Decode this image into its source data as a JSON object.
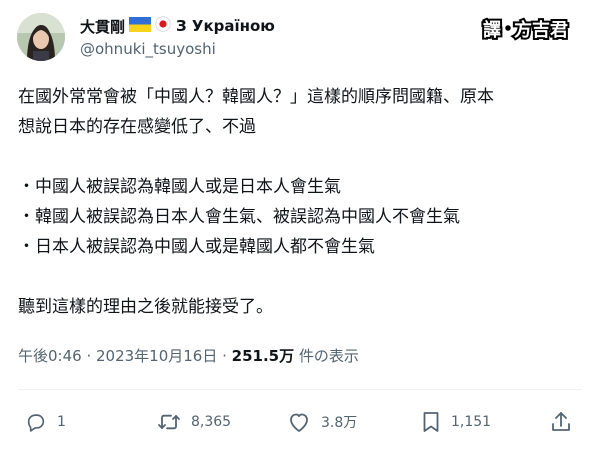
{
  "user": {
    "display_name": "大貫剛",
    "name_suffix": "З Україною",
    "handle": "@ohnuki_tsuyoshi"
  },
  "watermark": {
    "text": "譯方吉君"
  },
  "tweet": {
    "lines": [
      "在國外常常會被「中國人？韓國人？」這樣的順序問國籍、原本",
      "想說日本的存在感變低了、不過",
      "",
      "・中國人被誤認為韓國人或是日本人會生氣",
      "・韓國人被誤認為日本人會生氣、被誤認為中國人不會生氣",
      "・日本人被誤認為中國人或是韓國人都不會生氣",
      "",
      "聽到這樣的理由之後就能接受了。"
    ]
  },
  "meta": {
    "time": "午後0:46",
    "sep1": " · ",
    "date": "2023年10月16日",
    "sep2": " · ",
    "views": "251.5万",
    "views_label": " 件の表示"
  },
  "actions": {
    "reply_count": "1",
    "retweet_count": "8,365",
    "like_count": "3.8万",
    "bookmark_count": "1,151"
  },
  "icons": [
    "reply-icon",
    "retweet-icon",
    "like-icon",
    "bookmark-icon",
    "share-icon"
  ],
  "colors": {
    "text": "#0f1419",
    "muted": "#536471",
    "divider": "#eff3f4"
  }
}
